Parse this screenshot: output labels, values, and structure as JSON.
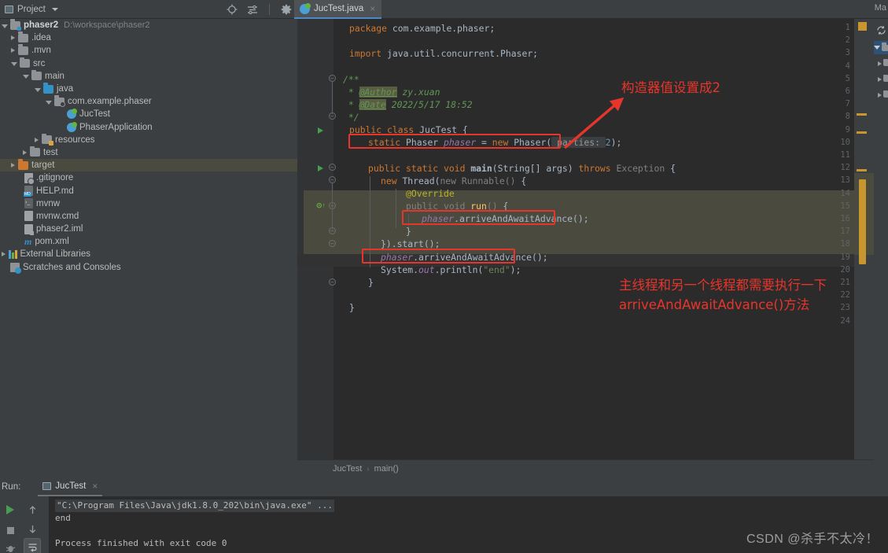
{
  "window": {
    "project_panel_title": "Project",
    "maven_panel_label": "Ma",
    "editor_tab": "JucTest.java",
    "breadcrumb": [
      "JucTest",
      "main()"
    ],
    "watermark": "CSDN @杀手不太冷！"
  },
  "toolbar": {
    "locate_icon": "crosshair-icon",
    "collapse_icon": "collapse-all-icon",
    "settings_icon": "gear-icon",
    "hide_icon": "minimize-icon"
  },
  "project_tree": [
    {
      "label": "phaser2",
      "path": "D:\\workspace\\phaser2",
      "icon": "module-folder-icon",
      "indent": 0,
      "twisty": "open",
      "bold": true
    },
    {
      "label": ".idea",
      "path": "",
      "icon": "folder-icon",
      "indent": 1,
      "twisty": "closed",
      "bold": false
    },
    {
      "label": ".mvn",
      "path": "",
      "icon": "folder-icon",
      "indent": 1,
      "twisty": "closed",
      "bold": false
    },
    {
      "label": "src",
      "path": "",
      "icon": "folder-icon",
      "indent": 1,
      "twisty": "open",
      "bold": false
    },
    {
      "label": "main",
      "path": "",
      "icon": "folder-icon",
      "indent": 2,
      "twisty": "open",
      "bold": false
    },
    {
      "label": "java",
      "path": "",
      "icon": "source-folder-icon",
      "indent": 3,
      "twisty": "open",
      "bold": false
    },
    {
      "label": "com.example.phaser",
      "path": "",
      "icon": "package-icon",
      "indent": 4,
      "twisty": "open",
      "bold": false
    },
    {
      "label": "JucTest",
      "path": "",
      "icon": "java-class-icon",
      "indent": 5,
      "twisty": "none",
      "bold": false
    },
    {
      "label": "PhaserApplication",
      "path": "",
      "icon": "spring-class-icon",
      "indent": 5,
      "twisty": "none",
      "bold": false
    },
    {
      "label": "resources",
      "path": "",
      "icon": "resources-folder-icon",
      "indent": 3,
      "twisty": "closed",
      "bold": false
    },
    {
      "label": "test",
      "path": "",
      "icon": "folder-icon",
      "indent": 2,
      "twisty": "closed",
      "bold": false
    },
    {
      "label": "target",
      "path": "",
      "icon": "target-folder-icon",
      "indent": 1,
      "twisty": "closed",
      "bold": false,
      "selected": true
    },
    {
      "label": ".gitignore",
      "path": "",
      "icon": "gitignore-file-icon",
      "indent": 2,
      "twisty": "none",
      "bold": false
    },
    {
      "label": "HELP.md",
      "path": "",
      "icon": "markdown-file-icon",
      "indent": 2,
      "twisty": "none",
      "bold": false
    },
    {
      "label": "mvnw",
      "path": "",
      "icon": "shell-file-icon",
      "indent": 2,
      "twisty": "none",
      "bold": false
    },
    {
      "label": "mvnw.cmd",
      "path": "",
      "icon": "cmd-file-icon",
      "indent": 2,
      "twisty": "none",
      "bold": false
    },
    {
      "label": "phaser2.iml",
      "path": "",
      "icon": "iml-file-icon",
      "indent": 2,
      "twisty": "none",
      "bold": false
    },
    {
      "label": "pom.xml",
      "path": "",
      "icon": "maven-pom-icon",
      "indent": 2,
      "twisty": "none",
      "bold": false
    },
    {
      "label": "External Libraries",
      "path": "",
      "icon": "libraries-icon",
      "indent": 0,
      "twisty": "closed",
      "bold": false
    },
    {
      "label": "Scratches and Consoles",
      "path": "",
      "icon": "scratches-icon",
      "indent": 0,
      "twisty": "none",
      "bold": false
    }
  ],
  "code": {
    "lines": [
      {
        "n": 1,
        "text": "package com.example.phaser;"
      },
      {
        "n": 2,
        "text": ""
      },
      {
        "n": 3,
        "text": "import java.util.concurrent.Phaser;"
      },
      {
        "n": 4,
        "text": ""
      },
      {
        "n": 5,
        "text": "/**"
      },
      {
        "n": 6,
        "text": " * @Author zy.xuan"
      },
      {
        "n": 7,
        "text": " * @Date 2022/5/17 18:52"
      },
      {
        "n": 8,
        "text": " */"
      },
      {
        "n": 9,
        "text": "public class JucTest {"
      },
      {
        "n": 10,
        "text": "    static Phaser phaser = new Phaser( parties: 2);"
      },
      {
        "n": 11,
        "text": ""
      },
      {
        "n": 12,
        "text": "    public static void main(String[] args) throws Exception {"
      },
      {
        "n": 13,
        "text": "        new Thread(new Runnable() {"
      },
      {
        "n": 14,
        "text": "            @Override"
      },
      {
        "n": 15,
        "text": "            public void run() {"
      },
      {
        "n": 16,
        "text": "                phaser.arriveAndAwaitAdvance();"
      },
      {
        "n": 17,
        "text": "            }"
      },
      {
        "n": 18,
        "text": "        }).start();"
      },
      {
        "n": 19,
        "text": "        phaser.arriveAndAwaitAdvance();"
      },
      {
        "n": 20,
        "text": "        System.out.println(\"end\");"
      },
      {
        "n": 21,
        "text": "    }"
      },
      {
        "n": 22,
        "text": ""
      },
      {
        "n": 23,
        "text": "}"
      },
      {
        "n": 24,
        "text": ""
      }
    ],
    "parameter_hint": "parties:",
    "constructor_value": "2",
    "string_literal": "\"end\""
  },
  "annotations": [
    {
      "text": "构造器值设置成2",
      "color": "#e8352b"
    },
    {
      "text": "主线程和另一个线程都需要执行一下",
      "color": "#e8352b"
    },
    {
      "text": "arriveAndAwaitAdvance()方法",
      "color": "#e8352b"
    }
  ],
  "run_panel": {
    "label": "Run:",
    "tab": "JucTest",
    "output": [
      "\"C:\\Program Files\\Java\\jdk1.8.0_202\\bin\\java.exe\" ...",
      "end",
      "",
      "Process finished with exit code 0"
    ],
    "buttons": {
      "rerun": "rerun-icon",
      "stop": "stop-icon",
      "debug": "debug-icon",
      "up": "scroll-up-icon",
      "down": "scroll-down-icon",
      "soft_wrap": "soft-wrap-icon"
    }
  },
  "colors": {
    "accent": "#4a88c7",
    "annotation_red": "#e8352b",
    "keyword": "#cc7832",
    "string": "#6a8759",
    "number": "#6897bb",
    "field": "#9876aa",
    "comment": "#629755",
    "method": "#ffc66d"
  }
}
